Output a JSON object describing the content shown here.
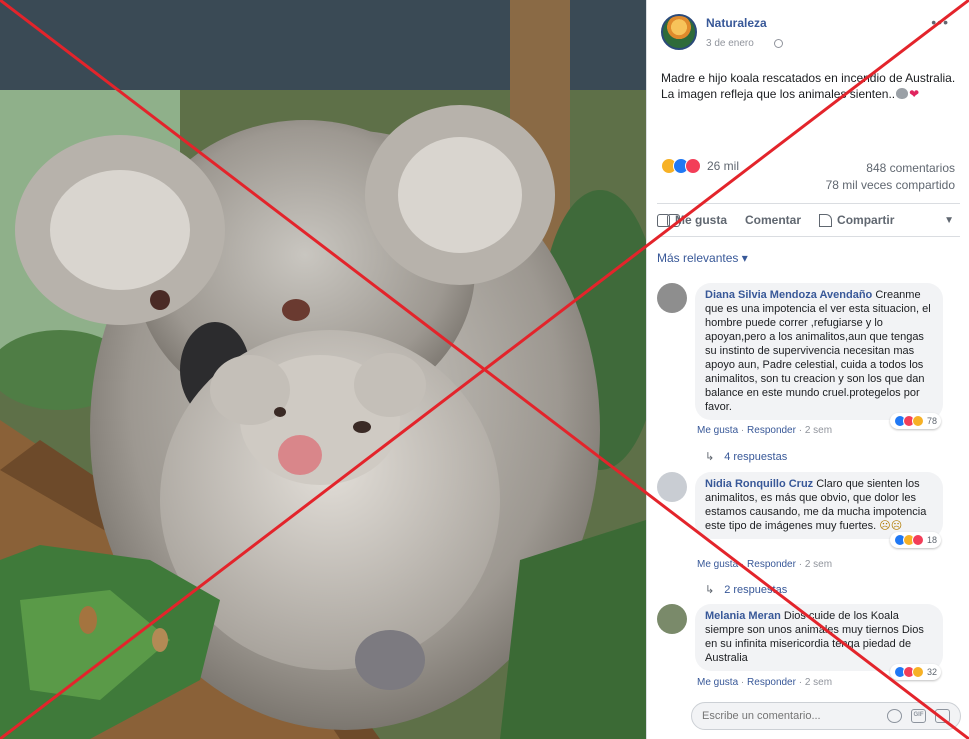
{
  "post": {
    "page_name": "Naturaleza",
    "date": "3 de enero",
    "more_icon": "more-icon",
    "text_line": "Madre e hijo koala rescatados en incendio de Australia. La imagen refleja que los animales sienten..",
    "reaction_count": "26 mil",
    "comments_count": "848 comentarios",
    "shares_count": "78 mil veces compartido"
  },
  "actions": {
    "like": "Me gusta",
    "comment": "Comentar",
    "share": "Compartir"
  },
  "sort_label": "Más relevantes ▾",
  "comments": [
    {
      "name": "Diana Silvia Mendoza Avendaño",
      "text": "Creanme que es una impotencia el ver esta situacion, el hombre puede correr ,refugiarse y lo apoyan,pero a los animalitos,aun que tengas su instinto de supervivencia necesitan mas apoyo aun, Padre celestial, cuida a todos los animalitos, son tu creacion y son los que dan balance en este mundo cruel.protegelos por favor.",
      "reactions": "78",
      "like": "Me gusta",
      "reply": "Responder",
      "time": "2 sem",
      "replies": "4 respuestas"
    },
    {
      "name": "Nidia Ronquillo Cruz",
      "text": "Claro que sienten los animalitos, es más que obvio, que dolor les estamos causando, me da mucha impotencia este tipo de imágenes muy fuertes.",
      "reactions": "18",
      "like": "Me gusta",
      "reply": "Responder",
      "time": "2 sem",
      "replies": "2 respuestas"
    },
    {
      "name": "Melania Meran",
      "text": "Dios cuide de los Koala siempre son unos animales muy tiernos Dios en su infinita misericordia tenga piedad de Australia",
      "reactions": "32",
      "like": "Me gusta",
      "reply": "Responder",
      "time": "2 sem"
    }
  ],
  "composer": {
    "placeholder": "Escribe un comentario..."
  },
  "colors": {
    "link": "#385898",
    "cross": "#e3242b",
    "like_blue": "#2078f4",
    "love_red": "#f33e58",
    "sad_yellow": "#f7b125"
  }
}
